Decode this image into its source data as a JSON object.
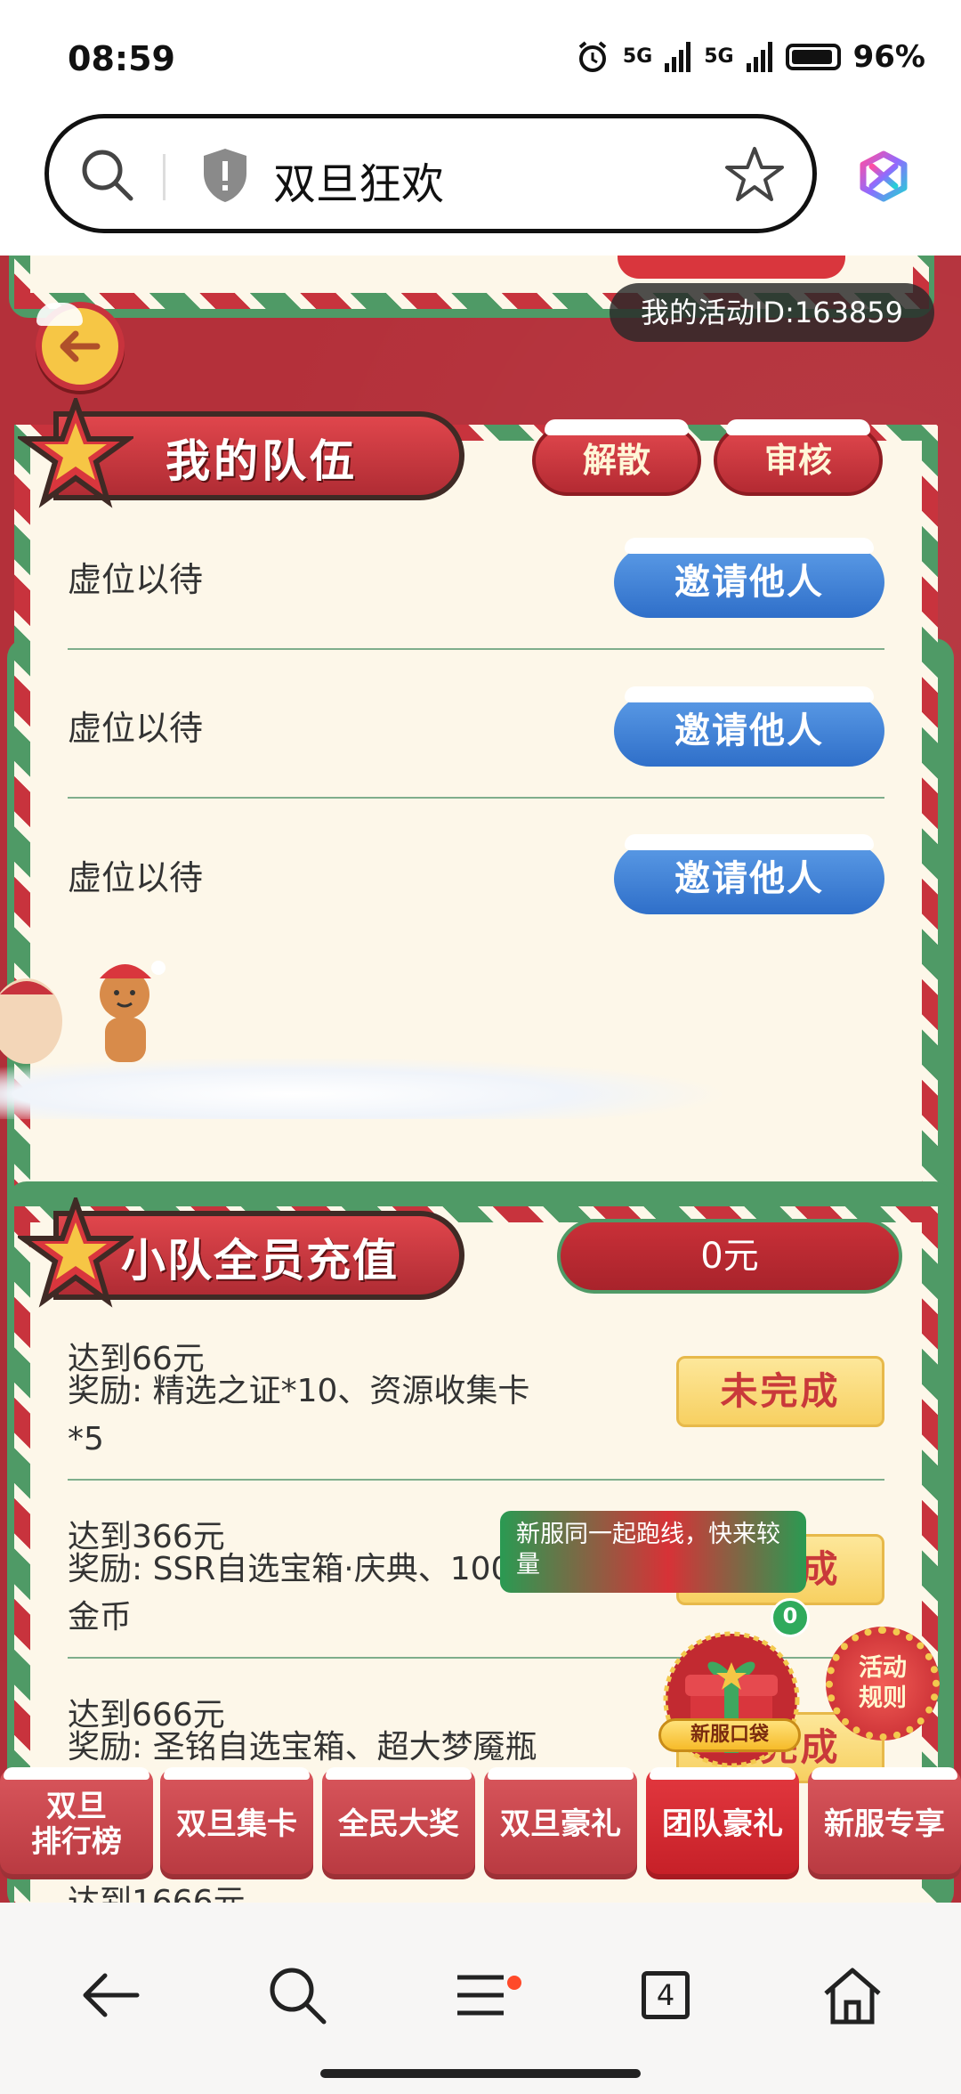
{
  "status_bar": {
    "time": "08:59",
    "network_1": "5G",
    "network_2": "5G",
    "battery": "96%"
  },
  "browser": {
    "search_text": "双旦狂欢"
  },
  "activity": {
    "id_label": "我的活动ID:163859"
  },
  "my_team": {
    "title": "我的队伍",
    "dissolve_label": "解散",
    "review_label": "审核",
    "slots": [
      {
        "label": "虚位以待",
        "button": "邀请他人"
      },
      {
        "label": "虚位以待",
        "button": "邀请他人"
      },
      {
        "label": "虚位以待",
        "button": "邀请他人"
      }
    ]
  },
  "team_recharge": {
    "title": "小队全员充值",
    "amount": "0元",
    "tiers": [
      {
        "target": "达到66元",
        "reward_line1": "奖励: 精选之证*10、资源收集卡",
        "reward_line2": "*5",
        "status": "未完成"
      },
      {
        "target": "达到366元",
        "reward_line1": "奖励: SSR自选宝箱·庆典、100",
        "reward_line2": "金币",
        "status": "未完成"
      },
      {
        "target": "达到666元",
        "reward_line1": "奖励: 圣铭自选宝箱、超大梦魇瓶",
        "reward_line2": "",
        "status": "未完成"
      }
    ],
    "peek_text": "达到1666元"
  },
  "toast": {
    "text": "新服同一起跑线，快来较量"
  },
  "gift": {
    "count": "0",
    "label": "新服口袋"
  },
  "rules": {
    "label": "活动\n规则"
  },
  "tabs": [
    {
      "label": "双旦\n排行榜",
      "active": false
    },
    {
      "label": "双旦集卡",
      "active": false
    },
    {
      "label": "全民大奖",
      "active": false
    },
    {
      "label": "双旦豪礼",
      "active": false
    },
    {
      "label": "团队豪礼",
      "active": true
    },
    {
      "label": "新服专享",
      "active": false
    }
  ],
  "nav": {
    "tab_count": "4"
  },
  "colors": {
    "game_bg": "#b4303a",
    "card_bg": "#fdf7e9",
    "accent_green": "#4f9a66",
    "invite_blue": "#2f6fc9",
    "status_yellow": "#f7d061"
  }
}
